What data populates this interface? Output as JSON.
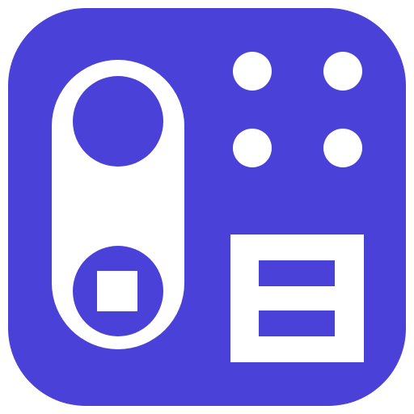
{
  "icon": {
    "name": "doorbell-intercom-app-icon",
    "colors": {
      "background": "#4a41d8",
      "foreground": "#ffffff"
    }
  }
}
